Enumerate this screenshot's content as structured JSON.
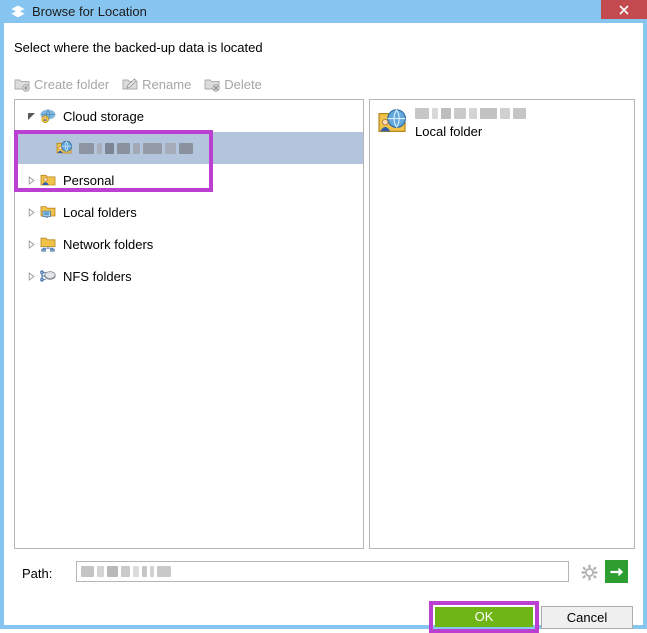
{
  "window": {
    "title": "Browse for Location",
    "title_icon": "layers-icon",
    "close_label": "×",
    "titlebar_color": "#86c5f0",
    "close_color": "#c34b4f"
  },
  "prompt": "Select where the backed-up data is located",
  "toolbar": {
    "items": [
      {
        "label": "Create folder",
        "icon": "new-folder-icon",
        "enabled": false
      },
      {
        "label": "Rename",
        "icon": "rename-pencil-icon",
        "enabled": false
      },
      {
        "label": "Delete",
        "icon": "delete-folder-icon",
        "enabled": false
      }
    ]
  },
  "tree": {
    "items": [
      {
        "label": "Cloud storage",
        "icon": "cloud-storage-icon",
        "expander": "expanded",
        "indent": 1,
        "selected": false
      },
      {
        "label": "",
        "redacted": true,
        "icon": "cloud-account-folder-icon",
        "expander": "none",
        "indent": 2,
        "selected": true
      },
      {
        "label": "Personal",
        "icon": "personal-folder-icon",
        "expander": "collapsed",
        "indent": 1,
        "selected": false
      },
      {
        "label": "Local folders",
        "icon": "local-folder-icon",
        "expander": "collapsed",
        "indent": 1,
        "selected": false
      },
      {
        "label": "Network folders",
        "icon": "network-folder-icon",
        "expander": "collapsed",
        "indent": 1,
        "selected": false
      },
      {
        "label": "NFS folders",
        "icon": "nfs-share-icon",
        "expander": "collapsed",
        "indent": 1,
        "selected": false
      }
    ],
    "selection_color": "#b3c4dd"
  },
  "detail": {
    "item": {
      "name": "",
      "redacted": true,
      "subtitle": "Local folder",
      "icon": "cloud-account-folder-icon"
    }
  },
  "path": {
    "label": "Path:",
    "value": "",
    "value_redacted": true,
    "placeholder": "",
    "gear_icon": "gear-icon",
    "go_icon": "arrow-right-icon",
    "go_color": "#2f9e30"
  },
  "buttons": {
    "ok_label": "OK",
    "ok_color": "#6fb516",
    "cancel_label": "Cancel"
  },
  "annotations": {
    "highlight_color": "#bb3fd0",
    "highlighted_targets": [
      "cloud-storage-subtree",
      "ok-button"
    ]
  }
}
